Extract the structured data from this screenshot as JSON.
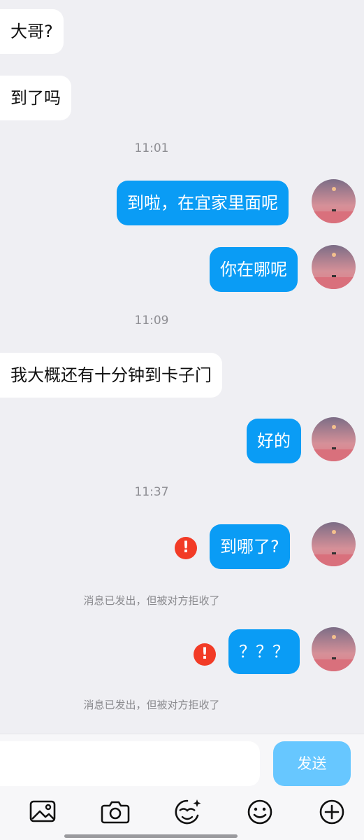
{
  "messages": {
    "m1": "大哥?",
    "m2": "到了吗",
    "t1": "11:01",
    "m3": "到啦，在宜家里面呢",
    "m4": "你在哪呢",
    "t2": "11:09",
    "m5": "我大概还有十分钟到卡子门",
    "m6": "好的",
    "t3": "11:37",
    "m7": "到哪了?",
    "n1": "消息已发出，但被对方拒收了",
    "m8": "？？？",
    "n2": "消息已发出，但被对方拒收了",
    "error_glyph": "!"
  },
  "input": {
    "value": "",
    "send_label": "发送"
  },
  "toolbar": {
    "icons": [
      "image-icon",
      "camera-icon",
      "sticker-icon",
      "emoji-icon",
      "plus-icon"
    ]
  },
  "colors": {
    "outgoing": "#0a9cf5",
    "incoming": "#ffffff",
    "send_button": "#67c7ff",
    "error": "#f23b26",
    "background": "#efeff3"
  }
}
